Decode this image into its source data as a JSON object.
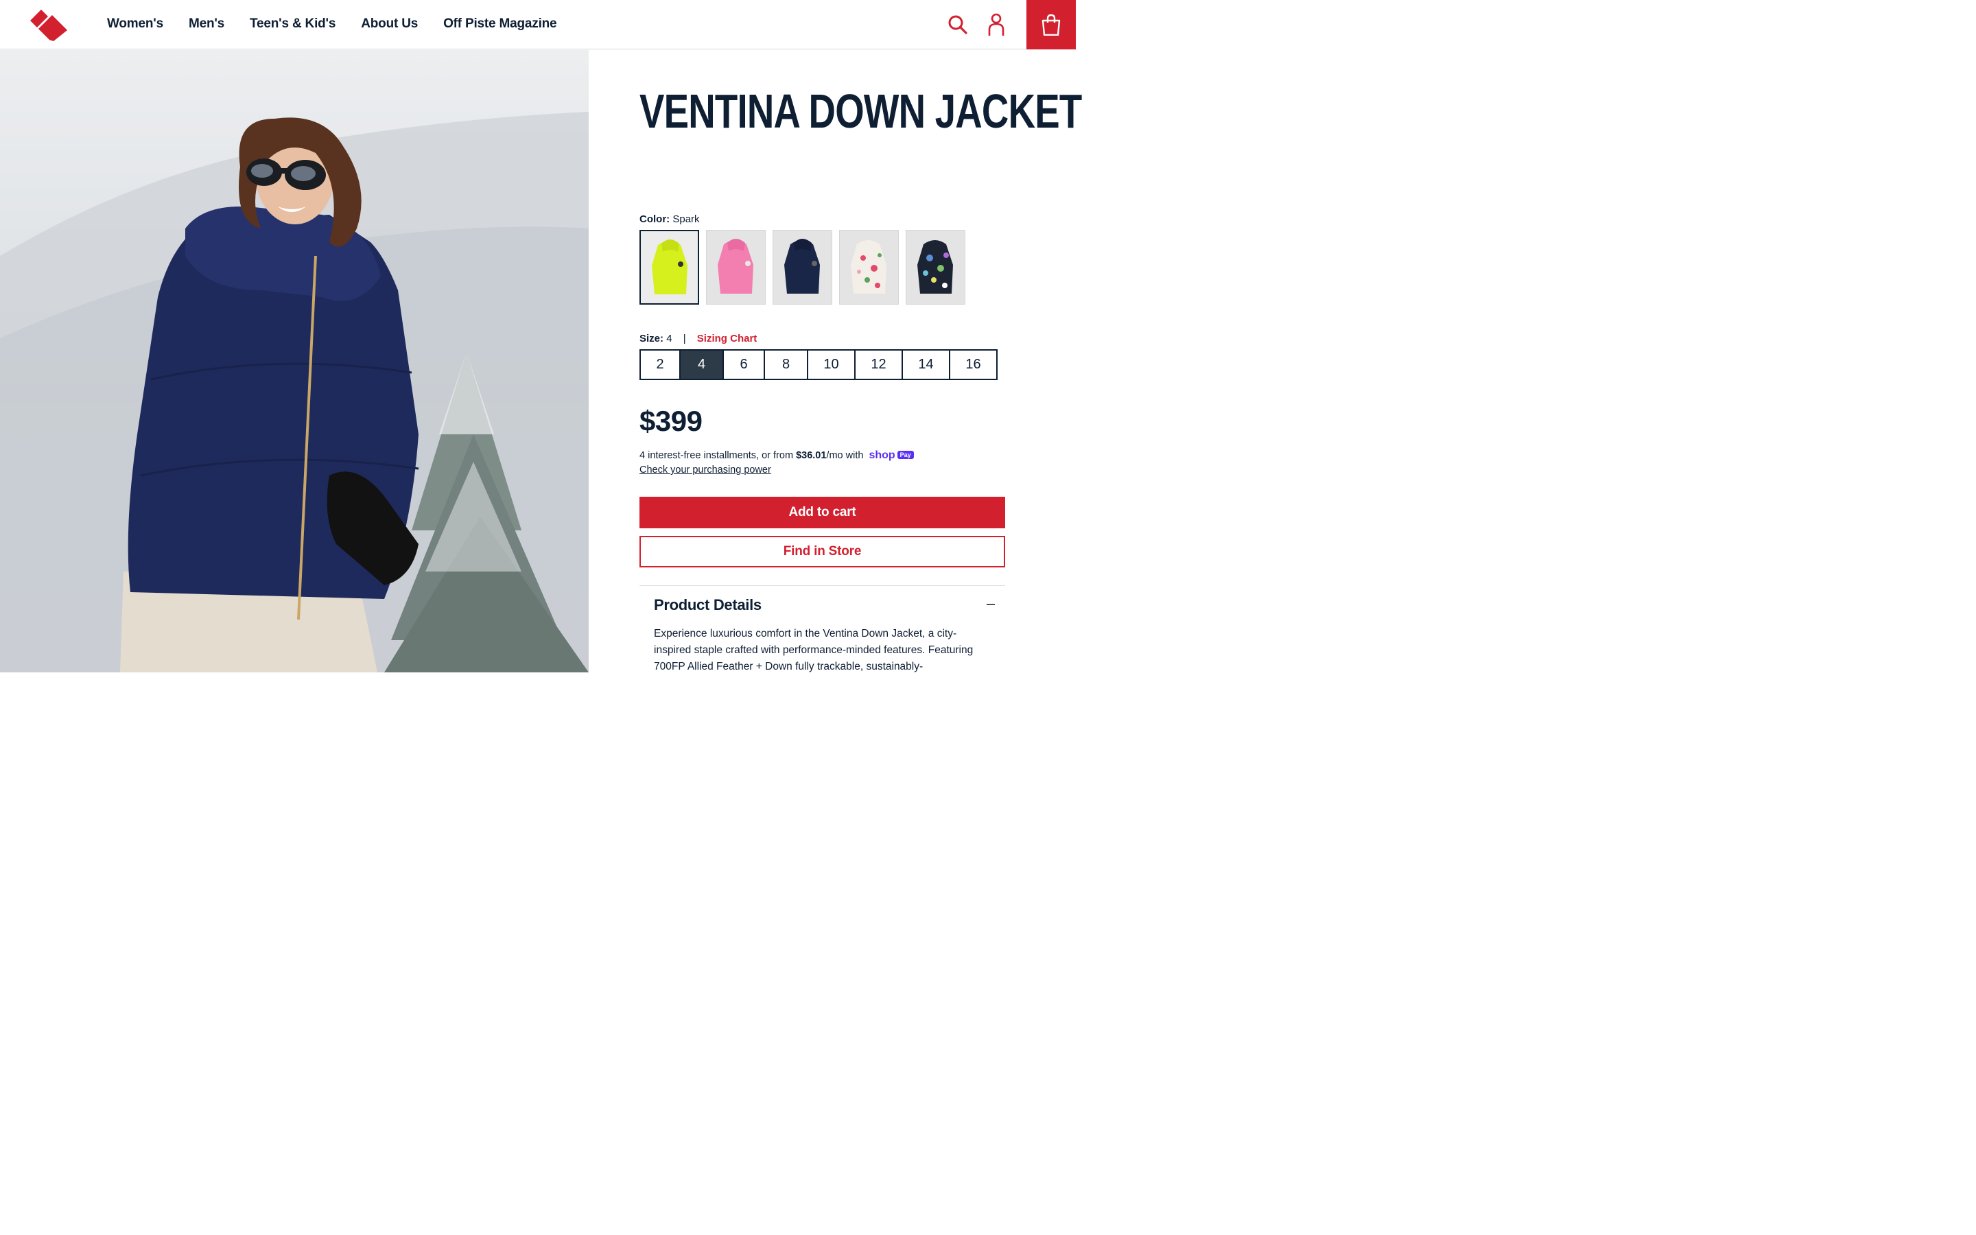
{
  "header": {
    "logo_name": "brand-logo",
    "nav": [
      "Women's",
      "Men's",
      "Teen's & Kid's",
      "About Us",
      "Off Piste Magazine"
    ],
    "icons": [
      "search-icon",
      "account-icon",
      "shopping-bag-icon"
    ],
    "accent": "#d2202f"
  },
  "product": {
    "title": "VENTINA DOWN JACKET",
    "color_label": "Color:",
    "color_value": "Spark",
    "swatches": [
      {
        "name": "Spark",
        "color": "#d6f01d",
        "selected": true
      },
      {
        "name": "Pink",
        "color": "#f37eb0",
        "selected": false
      },
      {
        "name": "Navy",
        "color": "#1a2648",
        "selected": false
      },
      {
        "name": "White Floral",
        "color": "#f3efe8",
        "selected": false
      },
      {
        "name": "Dark Floral",
        "color": "#1c2433",
        "selected": false
      }
    ],
    "size_label": "Size:",
    "size_value": "4",
    "size_separator": "|",
    "sizing_chart": "Sizing Chart",
    "sizes": [
      "2",
      "4",
      "6",
      "8",
      "10",
      "12",
      "14",
      "16"
    ],
    "selected_size": "4",
    "price": "$399",
    "installments_prefix": "4 interest-free installments, or from ",
    "installments_amount": "$36.01",
    "installments_suffix": "/mo with",
    "shop_logo": "shop",
    "shop_badge": "Pay",
    "power_link": "Check your purchasing power",
    "add_to_cart": "Add to cart",
    "find_in_store": "Find in Store",
    "details_heading": "Product Details",
    "details_toggle": "–",
    "details_text": "Experience luxurious comfort in the Ventina Down Jacket, a city-inspired staple crafted with performance-minded features. Featuring 700FP Allied Feather + Down fully trackable, sustainably-"
  }
}
